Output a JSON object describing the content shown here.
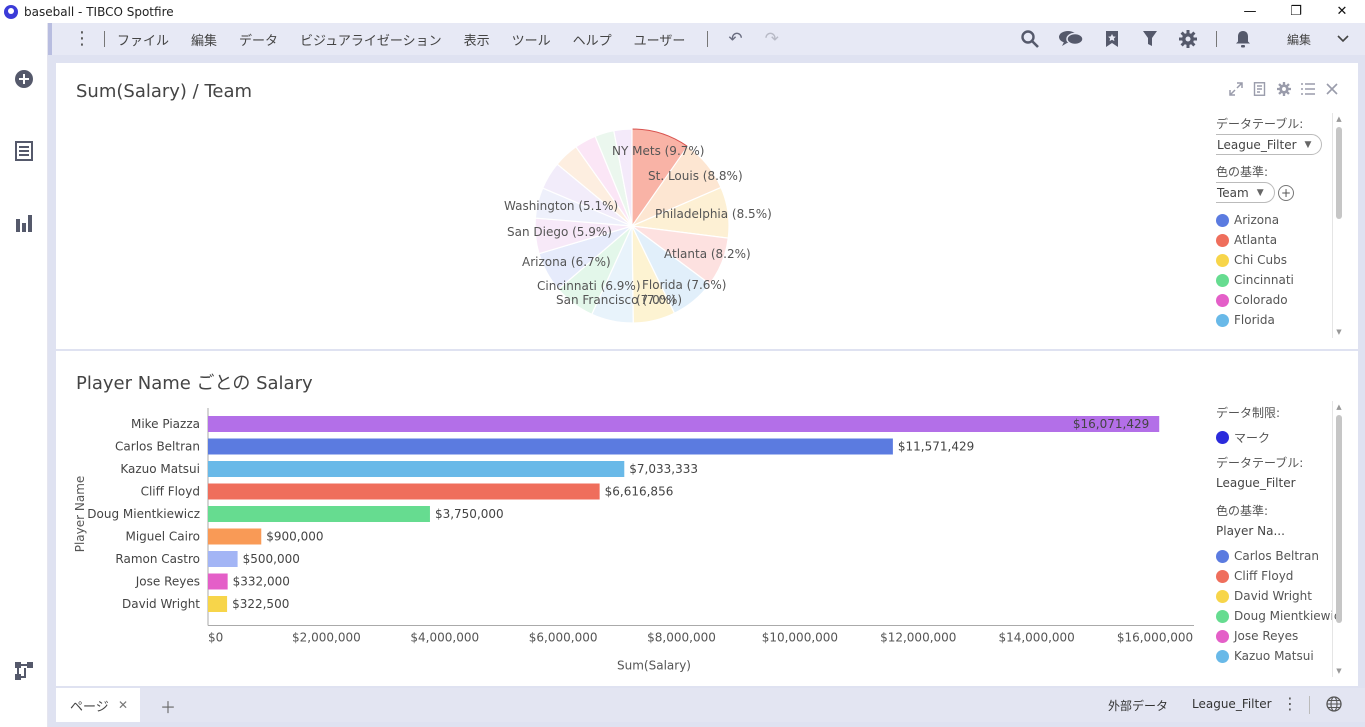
{
  "window": {
    "title": "baseball - TIBCO Spotfire",
    "minimize": "—",
    "maximize": "❐",
    "close": "✕"
  },
  "menu": {
    "items": [
      "ファイル",
      "編集",
      "データ",
      "ビジュアライゼーション",
      "表示",
      "ツール",
      "ヘルプ",
      "ユーザー"
    ],
    "mode": "編集"
  },
  "pie_panel": {
    "title": "Sum(Salary) / Team",
    "legend": {
      "table_label": "データテーブル:",
      "table_value": "League_Filter",
      "color_label": "色の基準:",
      "color_value": "Team",
      "items": [
        {
          "label": "Arizona",
          "color": "#5b7be0"
        },
        {
          "label": "Atlanta",
          "color": "#ef6e5c"
        },
        {
          "label": "Chi Cubs",
          "color": "#f7d54a"
        },
        {
          "label": "Cincinnati",
          "color": "#66dc90"
        },
        {
          "label": "Colorado",
          "color": "#e45fc8"
        },
        {
          "label": "Florida",
          "color": "#69b9e8"
        }
      ]
    }
  },
  "bar_panel": {
    "title": "Player Name ごとの Salary",
    "legend": {
      "limit_label": "データ制限:",
      "limit_value": "マーク",
      "limit_color": "#2b2bdc",
      "table_label": "データテーブル:",
      "table_value": "League_Filter",
      "color_label": "色の基準:",
      "color_value": "Player Na...",
      "items": [
        {
          "label": "Carlos Beltran",
          "color": "#5b7be0"
        },
        {
          "label": "Cliff Floyd",
          "color": "#ef6e5c"
        },
        {
          "label": "David Wright",
          "color": "#f7d54a"
        },
        {
          "label": "Doug Mientkiewicz",
          "color": "#66dc90"
        },
        {
          "label": "Jose Reyes",
          "color": "#e45fc8"
        },
        {
          "label": "Kazuo Matsui",
          "color": "#69b9e8"
        }
      ]
    }
  },
  "status": {
    "page_tab": "ページ",
    "external_data": "外部データ",
    "data_table": "League_Filter"
  },
  "chart_data": [
    {
      "type": "pie",
      "title": "Sum(Salary) / Team",
      "slices": [
        {
          "label": "NY Mets (9.7%)",
          "value": 9.7,
          "color": "#f9b3a6",
          "highlighted": true
        },
        {
          "label": "St. Louis (8.8%)",
          "value": 8.8,
          "color": "#fde6d2"
        },
        {
          "label": "Philadelphia (8.5%)",
          "value": 8.5,
          "color": "#fdf0d4"
        },
        {
          "label": "Atlanta (8.2%)",
          "value": 8.2,
          "color": "#fde1e0"
        },
        {
          "label": "Florida (7.6%)",
          "value": 7.6,
          "color": "#e1effa"
        },
        {
          "label": "(7.0%)",
          "value": 7.0,
          "color": "#fdf3d2"
        },
        {
          "label": "San Francisco (7.0%)",
          "value": 7.0,
          "color": "#e8f3fb"
        },
        {
          "label": "Cincinnati (6.9%)",
          "value": 6.9,
          "color": "#e3f7ea"
        },
        {
          "label": "Arizona (6.7%)",
          "value": 6.7,
          "color": "#e6ebfb"
        },
        {
          "label": "San Diego (5.9%)",
          "value": 5.9,
          "color": "#f7e9f8"
        },
        {
          "label": "Washington (5.1%)",
          "value": 5.1,
          "color": "#eef0fb"
        },
        {
          "label": "",
          "value": 4.6,
          "color": "#f2ecfa"
        },
        {
          "label": "",
          "value": 4.2,
          "color": "#fdeee0"
        },
        {
          "label": "",
          "value": 3.6,
          "color": "#fbe6f6"
        },
        {
          "label": "",
          "value": 3.2,
          "color": "#ebf7ee"
        },
        {
          "label": "",
          "value": 3.0,
          "color": "#f4eafa"
        }
      ]
    },
    {
      "type": "bar",
      "orientation": "horizontal",
      "title": "Player Name ごとの Salary",
      "xlabel": "Sum(Salary)",
      "ylabel": "Player Name",
      "xlim": [
        0,
        17000000
      ],
      "xticks": [
        {
          "value": 0,
          "label": "$0"
        },
        {
          "value": 2000000,
          "label": "$2,000,000"
        },
        {
          "value": 4000000,
          "label": "$4,000,000"
        },
        {
          "value": 6000000,
          "label": "$6,000,000"
        },
        {
          "value": 8000000,
          "label": "$8,000,000"
        },
        {
          "value": 10000000,
          "label": "$10,000,000"
        },
        {
          "value": 12000000,
          "label": "$12,000,000"
        },
        {
          "value": 14000000,
          "label": "$14,000,000"
        },
        {
          "value": 16000000,
          "label": "$16,000,000"
        }
      ],
      "bars": [
        {
          "category": "Mike Piazza",
          "value": 16071429,
          "label": "$16,071,429",
          "color": "#b36fe8"
        },
        {
          "category": "Carlos Beltran",
          "value": 11571429,
          "label": "$11,571,429",
          "color": "#5b7be0"
        },
        {
          "category": "Kazuo Matsui",
          "value": 7033333,
          "label": "$7,033,333",
          "color": "#69b9e8"
        },
        {
          "category": "Cliff Floyd",
          "value": 6616856,
          "label": "$6,616,856",
          "color": "#ef6e5c"
        },
        {
          "category": "Doug Mientkiewicz",
          "value": 3750000,
          "label": "$3,750,000",
          "color": "#66dc90"
        },
        {
          "category": "Miguel Cairo",
          "value": 900000,
          "label": "$900,000",
          "color": "#f99a56"
        },
        {
          "category": "Ramon Castro",
          "value": 500000,
          "label": "$500,000",
          "color": "#a3b5f5"
        },
        {
          "category": "Jose Reyes",
          "value": 332000,
          "label": "$332,000",
          "color": "#e45fc8"
        },
        {
          "category": "David Wright",
          "value": 322500,
          "label": "$322,500",
          "color": "#f7d54a"
        }
      ]
    }
  ]
}
